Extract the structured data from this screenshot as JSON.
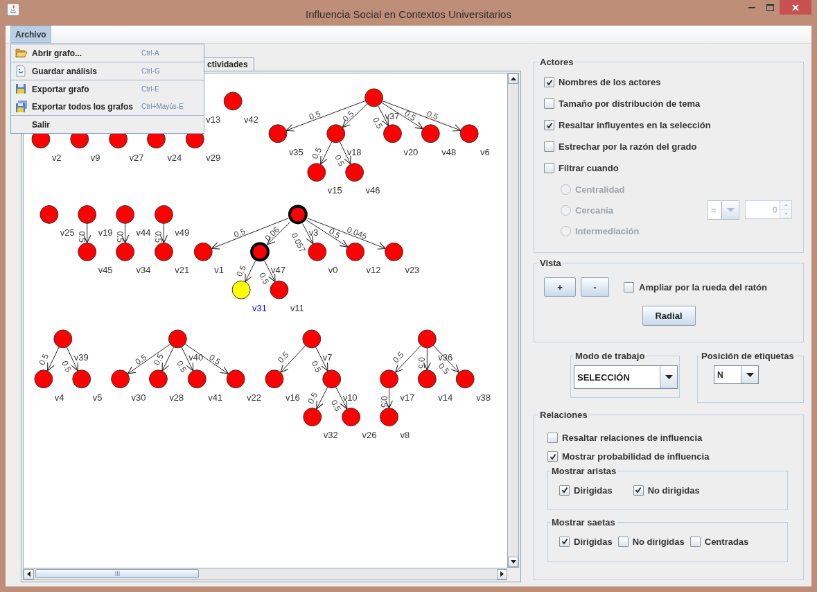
{
  "window": {
    "title": "Influencia Social en Contextos Universitarios"
  },
  "menu_bar": [
    {
      "label": "Archivo",
      "selected": true
    }
  ],
  "open_menu": {
    "groups": [
      [
        {
          "kind": "open",
          "label": "Abrir grafo...",
          "shortcut": "Ctrl-A"
        }
      ],
      [
        {
          "kind": "save",
          "label": "Guardar análisis",
          "shortcut": "Ctrl-G"
        }
      ],
      [
        {
          "kind": "export",
          "label": "Exportar grafo",
          "shortcut": "Ctrl-E"
        },
        {
          "kind": "export_all",
          "label": "Exportar todos los grafos",
          "shortcut": "Ctrl+Mayús-E"
        }
      ],
      [
        {
          "kind": "plain",
          "label": "Salir"
        }
      ]
    ]
  },
  "tabs": [
    {
      "label": "ctividades",
      "selected": true
    }
  ],
  "graph": {
    "trees": [
      {
        "kind": "node",
        "label": "v2",
        "influential": false,
        "selected": false
      },
      {
        "kind": "node",
        "label": "v9",
        "influential": false,
        "selected": false
      },
      {
        "kind": "node",
        "label": "v27",
        "influential": false,
        "selected": false
      },
      {
        "kind": "node",
        "label": "v24",
        "influential": false,
        "selected": false
      },
      {
        "kind": "node",
        "label": "v29",
        "influential": false,
        "selected": false
      },
      {
        "kind": "label",
        "label": "v13"
      },
      {
        "kind": "node",
        "label": "v42",
        "influential": false,
        "selected": false
      },
      {
        "kind": "node",
        "label": "v37",
        "influential": false,
        "selected": false,
        "children": [
          {
            "kind": "node",
            "label": "v35",
            "influential": false,
            "selected": false,
            "edge_label": "0.5"
          },
          {
            "kind": "node",
            "label": "v18",
            "influential": false,
            "selected": false,
            "edge_label": "0.5",
            "children": [
              {
                "kind": "node",
                "label": "v15",
                "influential": false,
                "selected": false,
                "edge_label": "0.5"
              },
              {
                "kind": "node",
                "label": "v46",
                "influential": false,
                "selected": false,
                "edge_label": "0.5"
              }
            ]
          },
          {
            "kind": "node",
            "label": "v20",
            "influential": false,
            "selected": false,
            "edge_label": "0.5"
          },
          {
            "kind": "node",
            "label": "v48",
            "influential": false,
            "selected": false,
            "edge_label": "0.5"
          },
          {
            "kind": "node",
            "label": "v6",
            "influential": false,
            "selected": false,
            "edge_label": "0.5"
          }
        ]
      },
      {
        "kind": "node",
        "label": "v25",
        "influential": false,
        "selected": false
      },
      {
        "kind": "node",
        "label": "v19",
        "influential": false,
        "selected": false,
        "children": [
          {
            "kind": "node",
            "label": "v45",
            "influential": false,
            "selected": false,
            "edge_label": "0.5"
          }
        ]
      },
      {
        "kind": "node",
        "label": "v44",
        "influential": false,
        "selected": false,
        "children": [
          {
            "kind": "node",
            "label": "v34",
            "influential": false,
            "selected": false,
            "edge_label": "0.5"
          }
        ]
      },
      {
        "kind": "node",
        "label": "v49",
        "influential": false,
        "selected": false,
        "children": [
          {
            "kind": "node",
            "label": "v21",
            "influential": false,
            "selected": false,
            "edge_label": "0.5"
          }
        ]
      },
      {
        "kind": "node",
        "label": "v3",
        "influential": true,
        "selected": false,
        "children": [
          {
            "kind": "node",
            "label": "v1",
            "influential": false,
            "selected": false,
            "edge_label": "0.5"
          },
          {
            "kind": "node",
            "label": "v47",
            "influential": true,
            "selected": false,
            "edge_label": "0.06",
            "children": [
              {
                "kind": "node",
                "label": "v31",
                "influential": false,
                "selected": true,
                "edge_label": "0.5"
              },
              {
                "kind": "node",
                "label": "v11",
                "influential": false,
                "selected": false,
                "edge_label": "0.5"
              }
            ]
          },
          {
            "kind": "node",
            "label": "v0",
            "influential": false,
            "selected": false,
            "edge_label": "0.057"
          },
          {
            "kind": "node",
            "label": "v12",
            "influential": false,
            "selected": false,
            "edge_label": "0.5"
          },
          {
            "kind": "node",
            "label": "v23",
            "influential": false,
            "selected": false,
            "edge_label": "0.045"
          }
        ]
      },
      {
        "kind": "node",
        "label": "v39",
        "influential": false,
        "selected": false,
        "children": [
          {
            "kind": "node",
            "label": "v4",
            "influential": false,
            "selected": false,
            "edge_label": "0.5"
          },
          {
            "kind": "node",
            "label": "v5",
            "influential": false,
            "selected": false,
            "edge_label": "0.5"
          }
        ]
      },
      {
        "kind": "node",
        "label": "v40",
        "influential": false,
        "selected": false,
        "children": [
          {
            "kind": "node",
            "label": "v30",
            "influential": false,
            "selected": false,
            "edge_label": "0.5"
          },
          {
            "kind": "node",
            "label": "v28",
            "influential": false,
            "selected": false,
            "edge_label": "0.5"
          },
          {
            "kind": "node",
            "label": "v41",
            "influential": false,
            "selected": false,
            "edge_label": "0.5"
          },
          {
            "kind": "node",
            "label": "v22",
            "influential": false,
            "selected": false,
            "edge_label": "0.5"
          }
        ]
      },
      {
        "kind": "node",
        "label": "v7",
        "influential": false,
        "selected": false,
        "children": [
          {
            "kind": "node",
            "label": "v16",
            "influential": false,
            "selected": false,
            "edge_label": "0.5"
          },
          {
            "kind": "node",
            "label": "v10",
            "influential": false,
            "selected": false,
            "edge_label": "0.5",
            "children": [
              {
                "kind": "node",
                "label": "v32",
                "influential": false,
                "selected": false,
                "edge_label": "0.5"
              },
              {
                "kind": "node",
                "label": "v26",
                "influential": false,
                "selected": false,
                "edge_label": "0.5"
              }
            ]
          }
        ]
      },
      {
        "kind": "node",
        "label": "v36",
        "influential": false,
        "selected": false,
        "children": [
          {
            "kind": "node",
            "label": "v17",
            "influential": false,
            "selected": false,
            "edge_label": "0.5",
            "children": [
              {
                "kind": "node",
                "label": "v8",
                "influential": false,
                "selected": false,
                "edge_label": "0.5"
              }
            ]
          },
          {
            "kind": "node",
            "label": "v14",
            "influential": false,
            "selected": false,
            "edge_label": "0.5"
          },
          {
            "kind": "node",
            "label": "v38",
            "influential": false,
            "selected": false,
            "edge_label": "0.5"
          }
        ]
      }
    ]
  },
  "actores": {
    "title": "Actores",
    "options": [
      {
        "label": "Nombres de los actores",
        "checked": true
      },
      {
        "label": "Tamaño por distribución de tema",
        "checked": false
      },
      {
        "label": "Resaltar influyentes en la selección",
        "checked": true
      },
      {
        "label": "Estrechar por la razón del grado",
        "checked": false
      },
      {
        "label": "Filtrar cuando",
        "checked": false
      }
    ],
    "filter": {
      "disabled": true,
      "radios": [
        {
          "label": "Centralidad",
          "selected": false
        },
        {
          "label": "Cercania",
          "selected": false
        },
        {
          "label": "Intermediación",
          "selected": false
        }
      ],
      "operator": "=",
      "value": "0"
    }
  },
  "vista": {
    "title": "Vista",
    "zoom_in": "+",
    "zoom_out": "-",
    "wheel": {
      "label": "Ampliar por la rueda del ratón",
      "checked": false
    },
    "radial": "Radial"
  },
  "modo_trabajo": {
    "title": "Modo de trabajo",
    "value": "SELECCIÓN"
  },
  "posicion_etiquetas": {
    "title": "Posición de etiquetas",
    "value": "N"
  },
  "relaciones": {
    "title": "Relaciones",
    "options": [
      {
        "label": "Resaltar relaciones de influencia",
        "checked": false
      },
      {
        "label": "Mostrar probabilidad de influencia",
        "checked": true
      }
    ],
    "groups": [
      {
        "title": "Mostrar aristas",
        "options": [
          {
            "label": "Dirigidas",
            "checked": true
          },
          {
            "label": "No dirigidas",
            "checked": true
          }
        ]
      },
      {
        "title": "Mostrar saetas",
        "options": [
          {
            "label": "Dirigidas",
            "checked": true
          },
          {
            "label": "No dirigidas",
            "checked": false
          },
          {
            "label": "Centradas",
            "checked": false
          }
        ]
      }
    ]
  }
}
